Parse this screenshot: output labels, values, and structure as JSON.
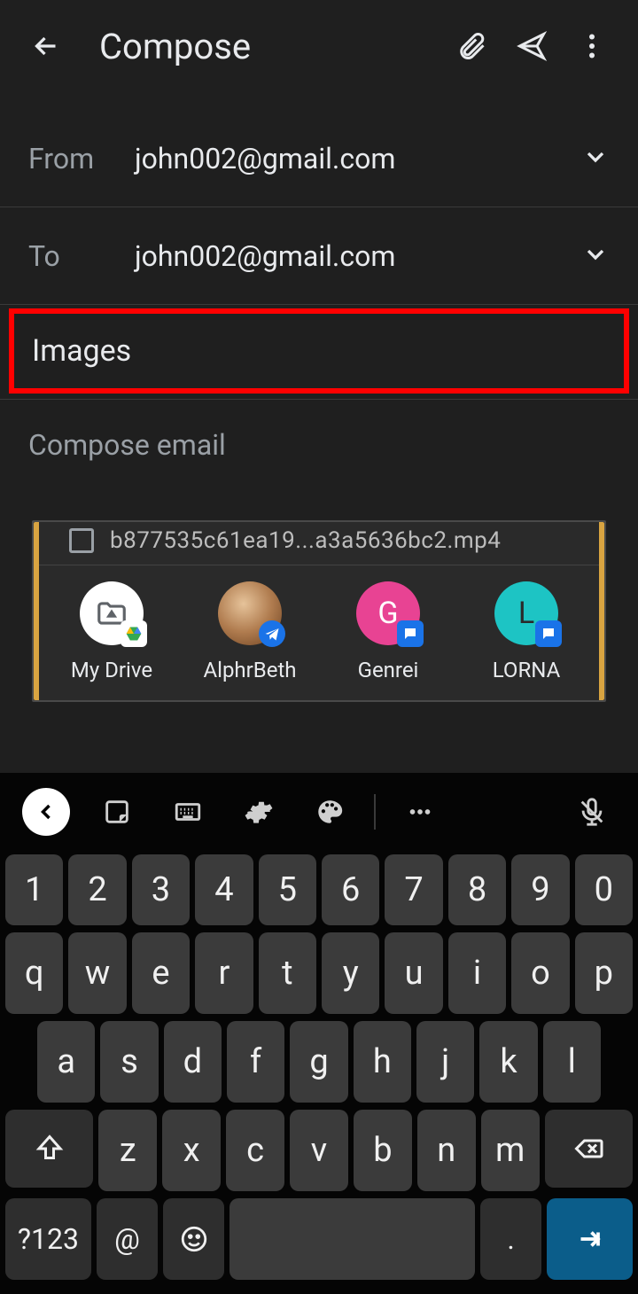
{
  "header": {
    "title": "Compose"
  },
  "from": {
    "label": "From",
    "value": "john002@gmail.com"
  },
  "to": {
    "label": "To",
    "value": "john002@gmail.com"
  },
  "subject": {
    "value": "Images"
  },
  "body": {
    "placeholder": "Compose email"
  },
  "attachment": {
    "filename": "b877535c61ea19...a3a5636bc2.mp4",
    "share_targets": [
      {
        "label": "My Drive",
        "bg": "#ffffff",
        "fg": "#5f6368",
        "letter": "",
        "badge_bg": "#ffffff",
        "badge_type": "drive",
        "icon": "folder"
      },
      {
        "label": "AlphrBeth",
        "bg": "#c58b5a",
        "fg": "#ffffff",
        "letter": "",
        "badge_bg": "#1a73e8",
        "badge_type": "telegram",
        "icon": "avatar"
      },
      {
        "label": "Genrei",
        "bg": "#e84393",
        "fg": "#ffffff",
        "letter": "G",
        "badge_bg": "#1a73e8",
        "badge_type": "messages",
        "icon": ""
      },
      {
        "label": "LORNA",
        "bg": "#1dc4c4",
        "fg": "#2a2a2a",
        "letter": "L",
        "badge_bg": "#1a73e8",
        "badge_type": "messages",
        "icon": ""
      }
    ]
  },
  "keyboard": {
    "row_num": [
      "1",
      "2",
      "3",
      "4",
      "5",
      "6",
      "7",
      "8",
      "9",
      "0"
    ],
    "row1": [
      "q",
      "w",
      "e",
      "r",
      "t",
      "y",
      "u",
      "i",
      "o",
      "p"
    ],
    "row2": [
      "a",
      "s",
      "d",
      "f",
      "g",
      "h",
      "j",
      "k",
      "l"
    ],
    "row3": [
      "z",
      "x",
      "c",
      "v",
      "b",
      "n",
      "m"
    ],
    "sym_label": "?123",
    "at_label": "@",
    "period_label": "."
  }
}
